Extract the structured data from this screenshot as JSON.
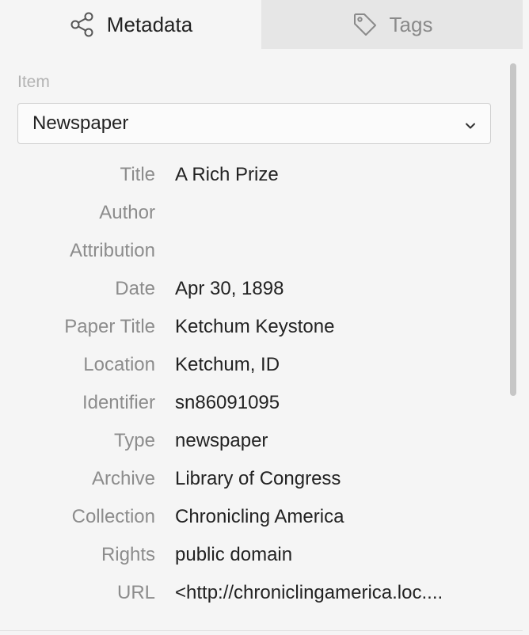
{
  "tabs": [
    {
      "label": "Metadata",
      "icon": "share-nodes-icon",
      "active": true
    },
    {
      "label": "Tags",
      "icon": "tag-icon",
      "active": false
    }
  ],
  "item": {
    "label": "Item",
    "selected": "Newspaper"
  },
  "fields": [
    {
      "label": "Title",
      "value": "A Rich Prize"
    },
    {
      "label": "Author",
      "value": ""
    },
    {
      "label": "Attribution",
      "value": ""
    },
    {
      "label": "Date",
      "value": "Apr 30, 1898"
    },
    {
      "label": "Paper Title",
      "value": "Ketchum Keystone"
    },
    {
      "label": "Location",
      "value": "Ketchum, ID"
    },
    {
      "label": "Identifier",
      "value": "sn86091095"
    },
    {
      "label": "Type",
      "value": "newspaper"
    },
    {
      "label": "Archive",
      "value": "Library of Congress"
    },
    {
      "label": "Collection",
      "value": "Chronicling America"
    },
    {
      "label": "Rights",
      "value": "public domain"
    },
    {
      "label": "URL",
      "value": "<http://chroniclingamerica.loc...."
    }
  ],
  "colors": {
    "background": "#f5f5f5",
    "inactive_tab": "#e6e6e6",
    "label_text": "#8c8c8c",
    "value_text": "#222222"
  }
}
